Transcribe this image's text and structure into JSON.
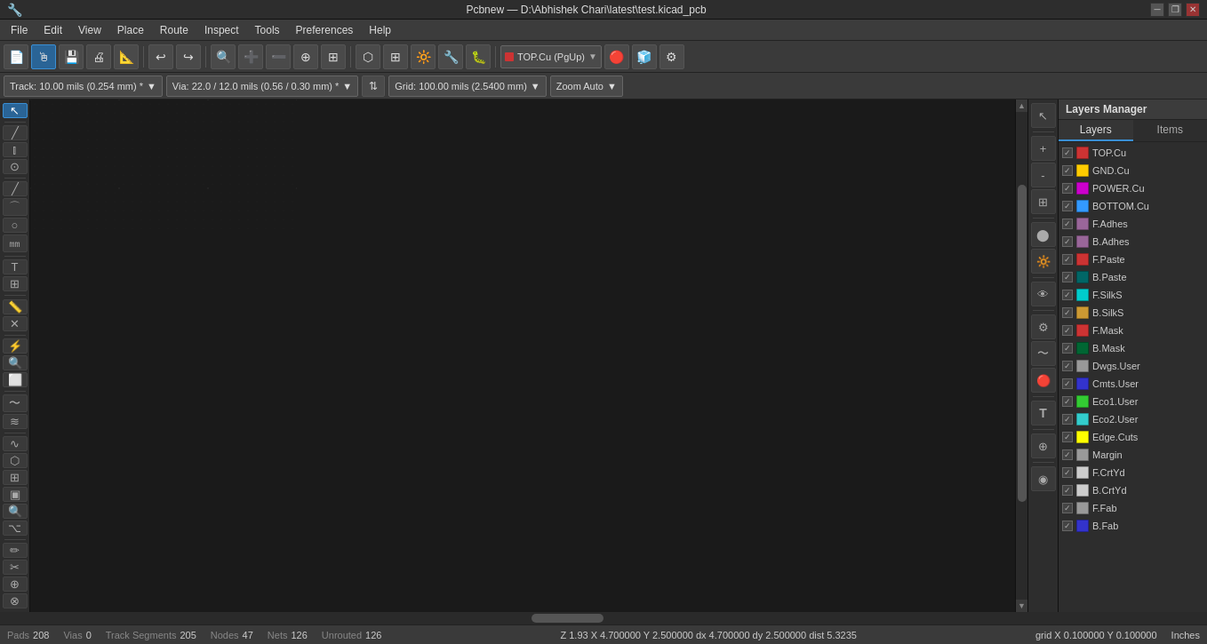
{
  "titlebar": {
    "title": "Pcbnew — D:\\Abhishek Chari\\latest\\test.kicad_pcb",
    "minimize": "🗕",
    "restore": "🗗",
    "close": "✕"
  },
  "menubar": {
    "items": [
      "File",
      "Edit",
      "View",
      "Place",
      "Route",
      "Inspect",
      "Tools",
      "Preferences",
      "Help"
    ]
  },
  "toolbar": {
    "buttons": [
      {
        "name": "new",
        "icon": "📄"
      },
      {
        "name": "open",
        "icon": "📁"
      },
      {
        "name": "save",
        "icon": "💾"
      },
      {
        "name": "print",
        "icon": "🖨"
      },
      {
        "name": "plot",
        "icon": "📊"
      }
    ],
    "layer_dropdown": {
      "label": "TOP.Cu (PgUp)",
      "color": "#cc0000"
    }
  },
  "toolbar2": {
    "track": "Track: 10.00 mils (0.254 mm) *",
    "via": "Via: 22.0 / 12.0 mils (0.56 / 0.30 mm) *",
    "grid": "Grid: 100.00 mils (2.5400 mm)",
    "zoom": "Zoom Auto"
  },
  "layers_panel": {
    "title": "Layers Manager",
    "tabs": [
      "Layers",
      "Items"
    ],
    "active_tab": 0,
    "layers": [
      {
        "name": "TOP.Cu",
        "color": "#cc3333",
        "visible": true,
        "active": false
      },
      {
        "name": "GND.Cu",
        "color": "#ffcc00",
        "visible": true,
        "active": false
      },
      {
        "name": "POWER.Cu",
        "color": "#cc00cc",
        "visible": true,
        "active": false
      },
      {
        "name": "BOTTOM.Cu",
        "color": "#3399ff",
        "visible": true,
        "active": false
      },
      {
        "name": "F.Adhes",
        "color": "#996699",
        "visible": true,
        "active": false
      },
      {
        "name": "B.Adhes",
        "color": "#996699",
        "visible": true,
        "active": false
      },
      {
        "name": "F.Paste",
        "color": "#cc3333",
        "visible": true,
        "active": false
      },
      {
        "name": "B.Paste",
        "color": "#006666",
        "visible": true,
        "active": false
      },
      {
        "name": "F.SilkS",
        "color": "#00cccc",
        "visible": true,
        "active": false
      },
      {
        "name": "B.SilkS",
        "color": "#cc9933",
        "visible": true,
        "active": false
      },
      {
        "name": "F.Mask",
        "color": "#cc3333",
        "visible": true,
        "active": false
      },
      {
        "name": "B.Mask",
        "color": "#006633",
        "visible": true,
        "active": false
      },
      {
        "name": "Dwgs.User",
        "color": "#999999",
        "visible": true,
        "active": false
      },
      {
        "name": "Cmts.User",
        "color": "#3333cc",
        "visible": true,
        "active": false
      },
      {
        "name": "Eco1.User",
        "color": "#33cc33",
        "visible": true,
        "active": false
      },
      {
        "name": "Eco2.User",
        "color": "#33cccc",
        "visible": true,
        "active": false
      },
      {
        "name": "Edge.Cuts",
        "color": "#ffff00",
        "visible": true,
        "active": false
      },
      {
        "name": "Margin",
        "color": "#999999",
        "visible": true,
        "active": false
      },
      {
        "name": "F.CrtYd",
        "color": "#cccccc",
        "visible": true,
        "active": false
      },
      {
        "name": "B.CrtYd",
        "color": "#cccccc",
        "visible": true,
        "active": false
      },
      {
        "name": "F.Fab",
        "color": "#999999",
        "visible": true,
        "active": false
      },
      {
        "name": "B.Fab",
        "color": "#3333cc",
        "visible": true,
        "active": false
      }
    ]
  },
  "statusbar": {
    "pads_label": "Pads",
    "pads_value": "208",
    "vias_label": "Vias",
    "vias_value": "0",
    "track_label": "Track Segments",
    "track_value": "205",
    "nodes_label": "Nodes",
    "nodes_value": "47",
    "nets_label": "Nets",
    "nets_value": "126",
    "unrouted_label": "Unrouted",
    "unrouted_value": "126",
    "coords": "Z 1.93    X 4.700000  Y 2.500000    dx 4.700000  dy 2.500000  dist 5.3235",
    "grid": "grid X 0.100000  Y 0.100000",
    "unit": "Inches"
  }
}
